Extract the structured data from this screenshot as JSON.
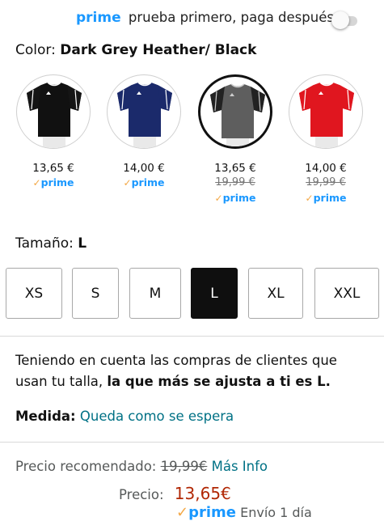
{
  "prime_banner": {
    "prime_word": "prime",
    "text": "prueba primero, paga después",
    "toggle_on": false
  },
  "color": {
    "label": "Color:",
    "value": "Dark Grey Heather/ Black",
    "options": [
      {
        "shirt_color": "#111111",
        "sleeve_color": "#151515",
        "trim_color": "#ffffff",
        "price": "13,65 €",
        "old_price": "",
        "prime": "prime",
        "selected": false
      },
      {
        "shirt_color": "#1b2a6b",
        "sleeve_color": "#1b2a6b",
        "trim_color": "#ffffff",
        "price": "14,00 €",
        "old_price": "",
        "prime": "prime",
        "selected": false
      },
      {
        "shirt_color": "#5e5e5e",
        "sleeve_color": "#222222",
        "trim_color": "#cccccc",
        "price": "13,65 €",
        "old_price": "19,99 €",
        "prime": "prime",
        "selected": true
      },
      {
        "shirt_color": "#e0161f",
        "sleeve_color": "#e0161f",
        "trim_color": "#ffffff",
        "price": "14,00 €",
        "old_price": "19,99 €",
        "prime": "prime",
        "selected": false
      }
    ]
  },
  "size": {
    "label": "Tamaño:",
    "value": "L",
    "options": [
      {
        "label": "XS",
        "selected": false
      },
      {
        "label": "S",
        "selected": false
      },
      {
        "label": "M",
        "selected": false
      },
      {
        "label": "L",
        "selected": true
      },
      {
        "label": "XL",
        "selected": false
      },
      {
        "label": "XXL",
        "selected": false
      }
    ]
  },
  "fit": {
    "text_before": "Teniendo en cuenta las compras de clientes que usan tu talla, ",
    "text_bold": "la que más se ajusta a ti es L."
  },
  "medida": {
    "label": "Medida:",
    "value": "Queda como se espera"
  },
  "pricing": {
    "recommended_label": "Precio recomendado:",
    "recommended_value": "19,99€",
    "more_info": "Más Info",
    "price_label": "Precio:",
    "price_value": "13,65€",
    "prime_word": "prime",
    "delivery": "Envío 1 día"
  },
  "colors": {
    "prime_blue": "#1a98ff",
    "prime_check": "#f3a847",
    "link": "#007185",
    "price_red": "#b12704"
  }
}
